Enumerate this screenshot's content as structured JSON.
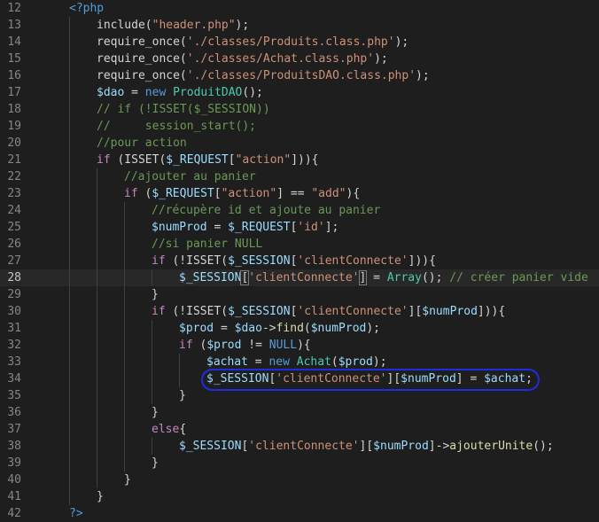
{
  "editor": {
    "language": "php",
    "colors": {
      "background": "#1e1e1e",
      "line_number": "#858585",
      "keyword": "#569cd6",
      "control": "#c586c0",
      "variable": "#9cdcfe",
      "string": "#ce9178",
      "function": "#dcdcaa",
      "class": "#4ec9b0",
      "comment": "#6a9955",
      "annotation_circle": "#1f2de0"
    },
    "lines": [
      {
        "n": "12",
        "indent": 0,
        "tokens": [
          [
            "tag",
            "<?php"
          ]
        ]
      },
      {
        "n": "13",
        "indent": 1,
        "tokens": [
          [
            "op",
            "include("
          ],
          [
            "str",
            "\"header.php\""
          ],
          [
            "op",
            ");"
          ]
        ]
      },
      {
        "n": "14",
        "indent": 1,
        "tokens": [
          [
            "op",
            "require_once("
          ],
          [
            "str",
            "'./classes/Produits.class.php'"
          ],
          [
            "op",
            ");"
          ]
        ]
      },
      {
        "n": "15",
        "indent": 1,
        "tokens": [
          [
            "op",
            "require_once("
          ],
          [
            "str",
            "'./classes/Achat.class.php'"
          ],
          [
            "op",
            ");"
          ]
        ]
      },
      {
        "n": "16",
        "indent": 1,
        "tokens": [
          [
            "op",
            "require_once("
          ],
          [
            "str",
            "'./classes/ProduitsDAO.class.php'"
          ],
          [
            "op",
            ");"
          ]
        ]
      },
      {
        "n": "17",
        "indent": 1,
        "tokens": [
          [
            "var",
            "$dao"
          ],
          [
            "op",
            " = "
          ],
          [
            "kw",
            "new"
          ],
          [
            "op",
            " "
          ],
          [
            "cls",
            "ProduitDAO"
          ],
          [
            "op",
            "();"
          ]
        ]
      },
      {
        "n": "18",
        "indent": 1,
        "tokens": [
          [
            "com",
            "// if (!ISSET($_SESSION))"
          ]
        ]
      },
      {
        "n": "19",
        "indent": 1,
        "tokens": [
          [
            "com",
            "//     session_start();"
          ]
        ]
      },
      {
        "n": "20",
        "indent": 1,
        "tokens": [
          [
            "com",
            "//pour action"
          ]
        ]
      },
      {
        "n": "21",
        "indent": 1,
        "tokens": [
          [
            "ctrl",
            "if"
          ],
          [
            "op",
            " (ISSET("
          ],
          [
            "var",
            "$_REQUEST"
          ],
          [
            "op",
            "["
          ],
          [
            "str",
            "\"action\""
          ],
          [
            "op",
            "])){"
          ]
        ]
      },
      {
        "n": "22",
        "indent": 2,
        "tokens": [
          [
            "com",
            "//ajouter au panier"
          ]
        ]
      },
      {
        "n": "23",
        "indent": 2,
        "tokens": [
          [
            "ctrl",
            "if"
          ],
          [
            "op",
            " ("
          ],
          [
            "var",
            "$_REQUEST"
          ],
          [
            "op",
            "["
          ],
          [
            "str",
            "\"action\""
          ],
          [
            "op",
            "] == "
          ],
          [
            "str",
            "\"add\""
          ],
          [
            "op",
            "){"
          ]
        ]
      },
      {
        "n": "24",
        "indent": 3,
        "tokens": [
          [
            "com",
            "//récupère id et ajoute au panier"
          ]
        ]
      },
      {
        "n": "25",
        "indent": 3,
        "tokens": [
          [
            "var",
            "$numProd"
          ],
          [
            "op",
            " = "
          ],
          [
            "var",
            "$_REQUEST"
          ],
          [
            "op",
            "["
          ],
          [
            "str",
            "'id'"
          ],
          [
            "op",
            "];"
          ]
        ]
      },
      {
        "n": "26",
        "indent": 3,
        "tokens": [
          [
            "com",
            "//si panier NULL"
          ]
        ]
      },
      {
        "n": "27",
        "indent": 3,
        "tokens": [
          [
            "ctrl",
            "if"
          ],
          [
            "op",
            " (!ISSET("
          ],
          [
            "var",
            "$_SESSION"
          ],
          [
            "op",
            "["
          ],
          [
            "str",
            "'clientConnecte'"
          ],
          [
            "op",
            "])){"
          ]
        ]
      },
      {
        "n": "28",
        "indent": 4,
        "current": true,
        "tokens": [
          [
            "var",
            "$_SESSION"
          ],
          [
            "op",
            "["
          ],
          [
            "str",
            "'clientConnecte'"
          ],
          [
            "op",
            "] = "
          ],
          [
            "cls",
            "Array"
          ],
          [
            "op",
            "(); "
          ],
          [
            "com",
            "// créer panier vide"
          ]
        ]
      },
      {
        "n": "29",
        "indent": 3,
        "tokens": [
          [
            "op",
            "}"
          ]
        ]
      },
      {
        "n": "30",
        "indent": 3,
        "tokens": [
          [
            "ctrl",
            "if"
          ],
          [
            "op",
            " (!ISSET("
          ],
          [
            "var",
            "$_SESSION"
          ],
          [
            "op",
            "["
          ],
          [
            "str",
            "'clientConnecte'"
          ],
          [
            "op",
            "]["
          ],
          [
            "var",
            "$numProd"
          ],
          [
            "op",
            "])){"
          ]
        ]
      },
      {
        "n": "31",
        "indent": 4,
        "tokens": [
          [
            "var",
            "$prod"
          ],
          [
            "op",
            " = "
          ],
          [
            "var",
            "$dao"
          ],
          [
            "op",
            "->"
          ],
          [
            "fn",
            "find"
          ],
          [
            "op",
            "("
          ],
          [
            "var",
            "$numProd"
          ],
          [
            "op",
            ");"
          ]
        ]
      },
      {
        "n": "32",
        "indent": 4,
        "tokens": [
          [
            "ctrl",
            "if"
          ],
          [
            "op",
            " ("
          ],
          [
            "var",
            "$prod"
          ],
          [
            "op",
            " != "
          ],
          [
            "kw",
            "NULL"
          ],
          [
            "op",
            "){"
          ]
        ]
      },
      {
        "n": "33",
        "indent": 5,
        "tokens": [
          [
            "var",
            "$achat"
          ],
          [
            "op",
            " = "
          ],
          [
            "kw",
            "new"
          ],
          [
            "op",
            " "
          ],
          [
            "cls",
            "Achat"
          ],
          [
            "op",
            "("
          ],
          [
            "var",
            "$prod"
          ],
          [
            "op",
            ");"
          ]
        ]
      },
      {
        "n": "34",
        "indent": 5,
        "circled": true,
        "tokens": [
          [
            "var",
            "$_SESSION"
          ],
          [
            "op",
            "["
          ],
          [
            "str",
            "'clientConnecte'"
          ],
          [
            "op",
            "]["
          ],
          [
            "var",
            "$numProd"
          ],
          [
            "op",
            "] = "
          ],
          [
            "var",
            "$achat"
          ],
          [
            "op",
            ";"
          ]
        ]
      },
      {
        "n": "35",
        "indent": 4,
        "tokens": [
          [
            "op",
            "}"
          ]
        ]
      },
      {
        "n": "36",
        "indent": 3,
        "tokens": [
          [
            "op",
            "}"
          ]
        ]
      },
      {
        "n": "37",
        "indent": 3,
        "tokens": [
          [
            "ctrl",
            "else"
          ],
          [
            "op",
            "{"
          ]
        ]
      },
      {
        "n": "38",
        "indent": 4,
        "tokens": [
          [
            "var",
            "$_SESSION"
          ],
          [
            "op",
            "["
          ],
          [
            "str",
            "'clientConnecte'"
          ],
          [
            "op",
            "]["
          ],
          [
            "var",
            "$numProd"
          ],
          [
            "op",
            "]->"
          ],
          [
            "fn",
            "ajouterUnite"
          ],
          [
            "op",
            "();"
          ]
        ]
      },
      {
        "n": "39",
        "indent": 3,
        "tokens": [
          [
            "op",
            "}"
          ]
        ]
      },
      {
        "n": "40",
        "indent": 2,
        "tokens": [
          [
            "op",
            "}"
          ]
        ]
      },
      {
        "n": "41",
        "indent": 1,
        "tokens": [
          [
            "op",
            "}"
          ]
        ]
      },
      {
        "n": "42",
        "indent": 0,
        "tokens": [
          [
            "tag",
            "?>"
          ]
        ]
      }
    ]
  }
}
